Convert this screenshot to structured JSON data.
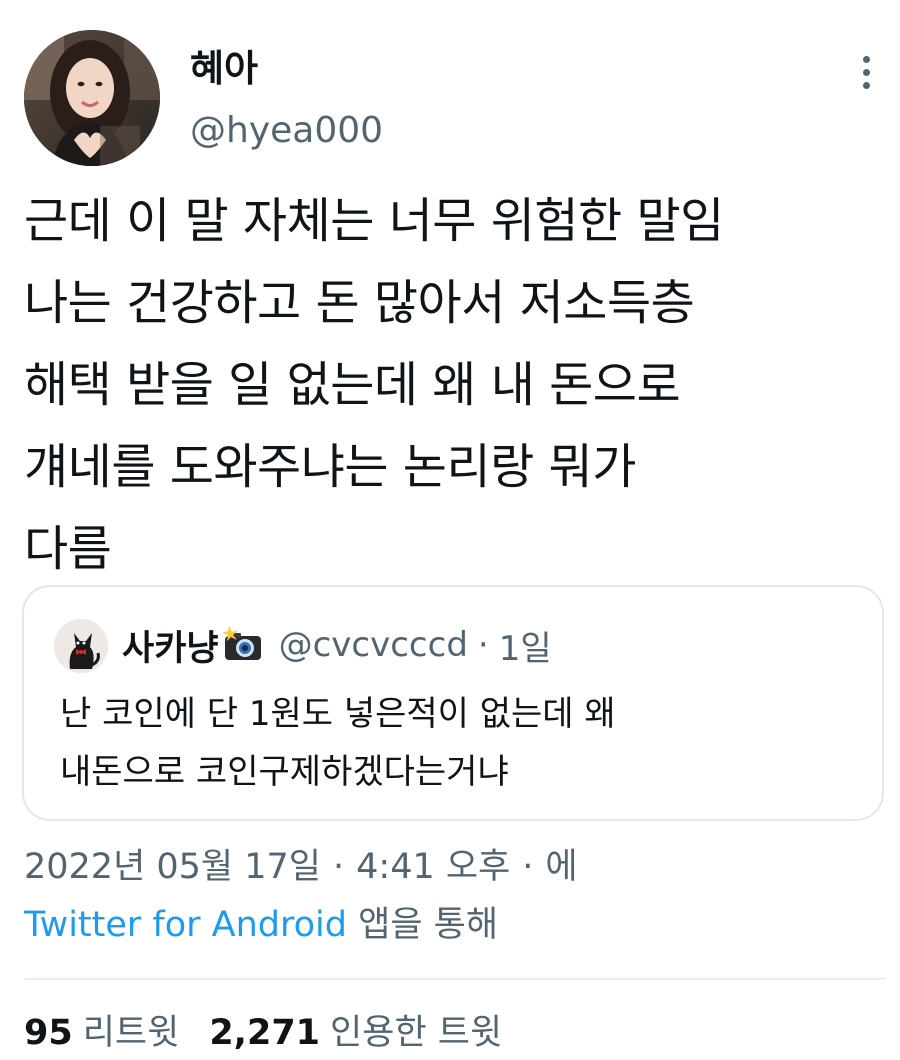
{
  "author": {
    "display_name": "혜아",
    "handle": "@hyea000",
    "avatar_icon": "profile-photo"
  },
  "more_icon": "more-vertical-icon",
  "tweet_lines": [
    "근데 이 말 자체는 너무 위험한 말임",
    "나는 건강하고 돈 많아서 저소득층",
    "해택 받을 일 없는데 왜 내 돈으로",
    "걔네를 도와주냐는 논리랑 뭐가",
    "다름"
  ],
  "quoted": {
    "display_name": "사카냥",
    "emoji_icon": "camera-with-flash-icon",
    "handle": "@cvcvcccd",
    "separator": "·",
    "time": "1일",
    "lines": [
      "난 코인에 단 1원도 넣은적이 없는데 왜",
      "내돈으로 코인구제하겠다는거냐"
    ]
  },
  "meta": {
    "date": "2022년 05월 17일",
    "time": "4:41 오후",
    "separator": "·",
    "suffix": "에",
    "source_link": "Twitter for Android",
    "source_suffix": " 앱을 통해"
  },
  "stats": {
    "retweets_count": "95",
    "retweets_label": "리트윗",
    "quotes_count": "2,271",
    "quotes_label": "인용한 트윗"
  },
  "colors": {
    "text": "#0f1419",
    "secondary": "#536471",
    "link": "#1d9bf0",
    "border": "#e3e7ea"
  }
}
